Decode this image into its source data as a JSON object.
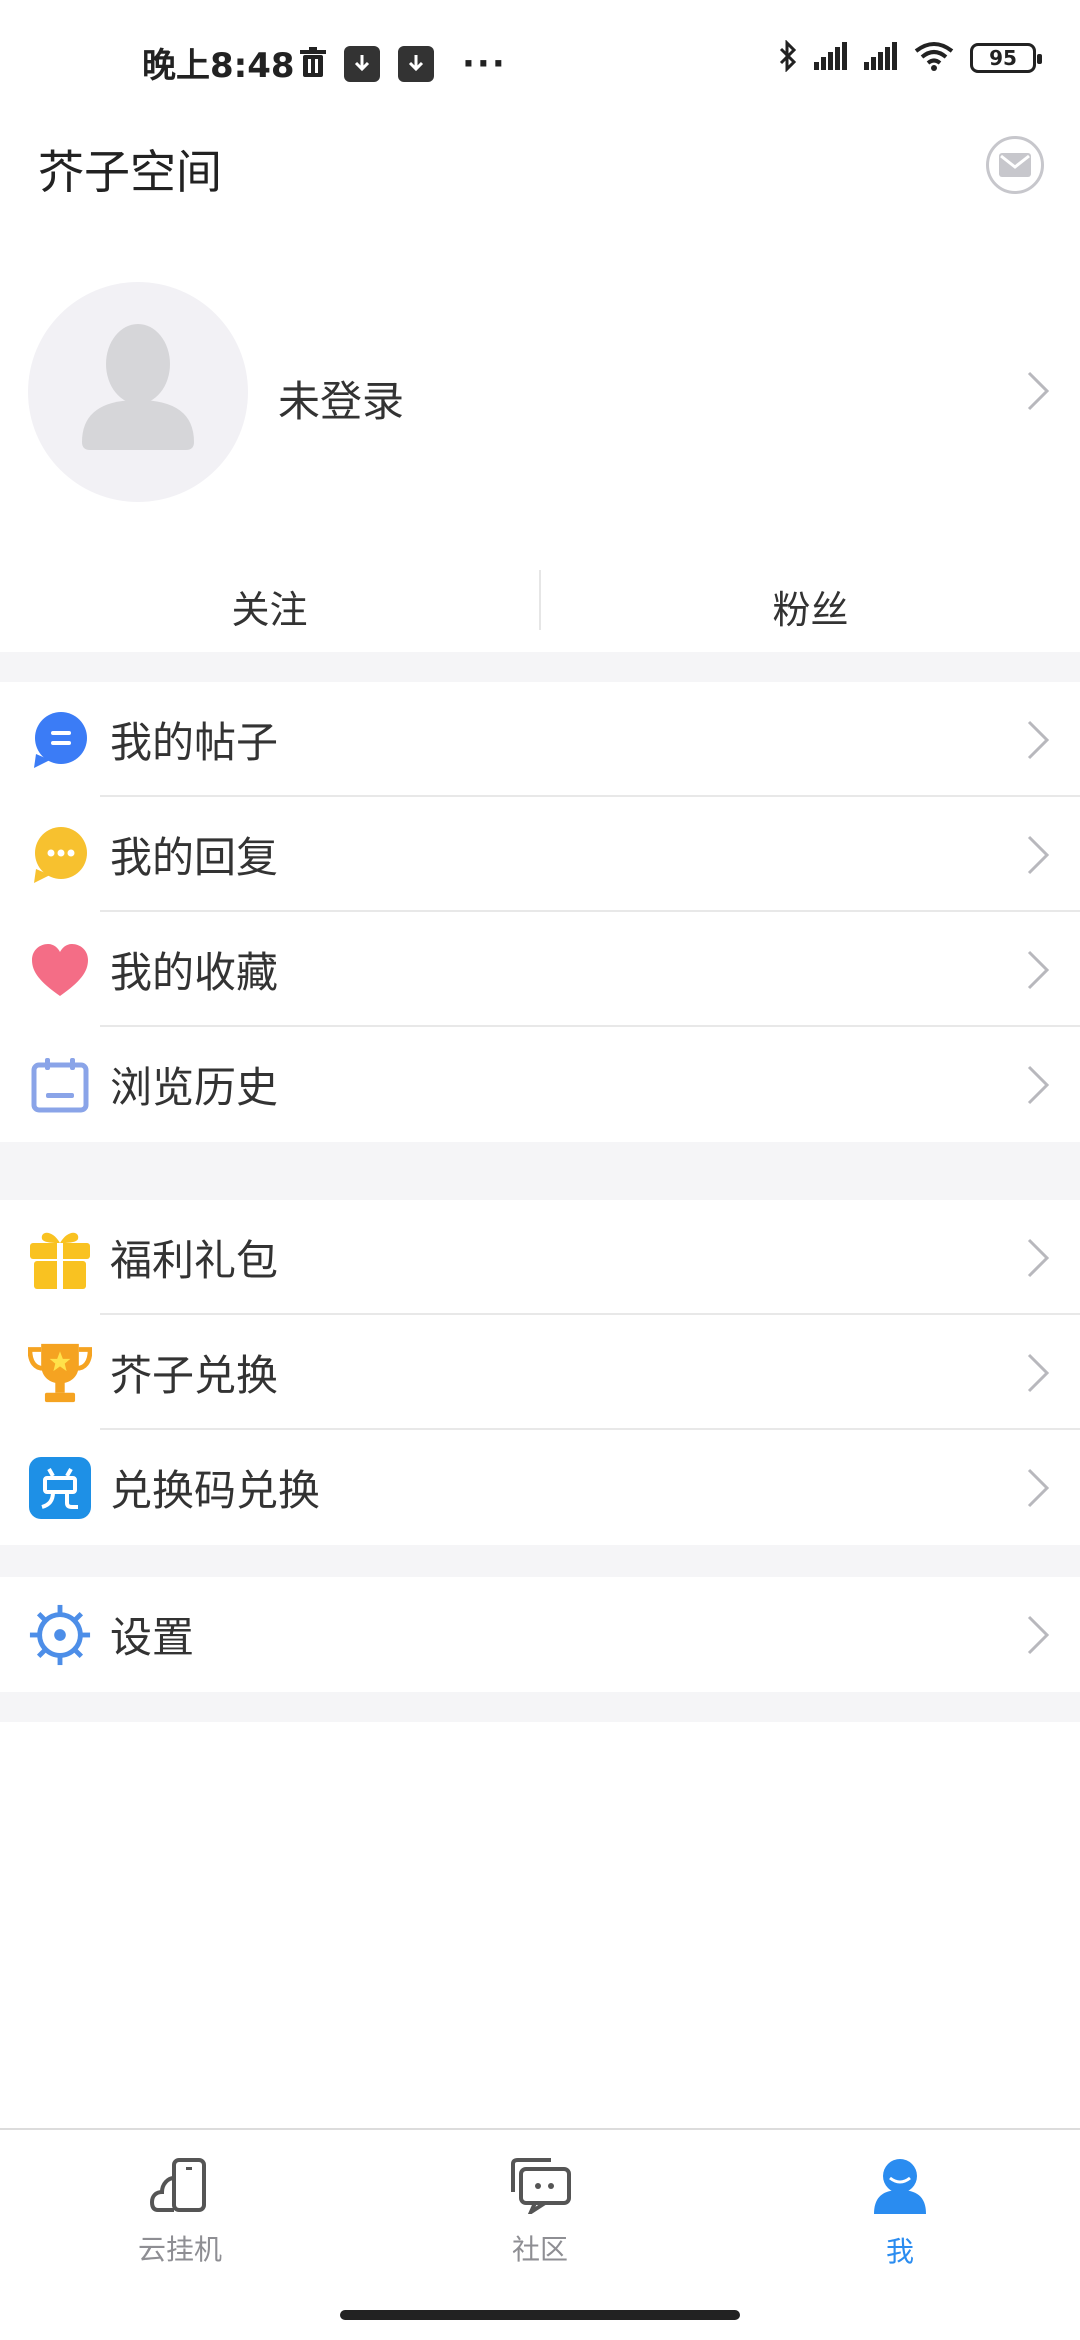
{
  "status_bar": {
    "time": "晚上8:48",
    "more": "···",
    "battery": "95"
  },
  "header": {
    "title": "芥子空间"
  },
  "profile": {
    "login_text": "未登录"
  },
  "stats": {
    "following": "关注",
    "fans": "粉丝"
  },
  "menu_group_1": [
    {
      "label": "我的帖子",
      "icon": "post-bubble-icon"
    },
    {
      "label": "我的回复",
      "icon": "reply-bubble-icon"
    },
    {
      "label": "我的收藏",
      "icon": "heart-icon"
    },
    {
      "label": "浏览历史",
      "icon": "calendar-icon"
    }
  ],
  "menu_group_2": [
    {
      "label": "福利礼包",
      "icon": "gift-icon"
    },
    {
      "label": "芥子兑换",
      "icon": "trophy-icon"
    },
    {
      "label": "兑换码兑换",
      "icon": "redeem-code-icon"
    }
  ],
  "menu_group_3": [
    {
      "label": "设置",
      "icon": "settings-icon"
    }
  ],
  "tabbar": {
    "tabs": [
      {
        "label": "云挂机",
        "icon": "cloud-phone-icon"
      },
      {
        "label": "社区",
        "icon": "community-chat-icon"
      },
      {
        "label": "我",
        "icon": "user-icon"
      }
    ],
    "active_index": 2
  },
  "colors": {
    "accent": "#2a8cf0",
    "post_blue": "#3b7cf6",
    "reply_yellow": "#f7c12f",
    "heart_pink": "#f46d86",
    "calendar_blue": "#8aa4e8",
    "gift_yellow": "#f9c221",
    "trophy_orange": "#f5a321",
    "redeem_blue": "#1e90e6",
    "settings_blue": "#4d8ee8"
  }
}
